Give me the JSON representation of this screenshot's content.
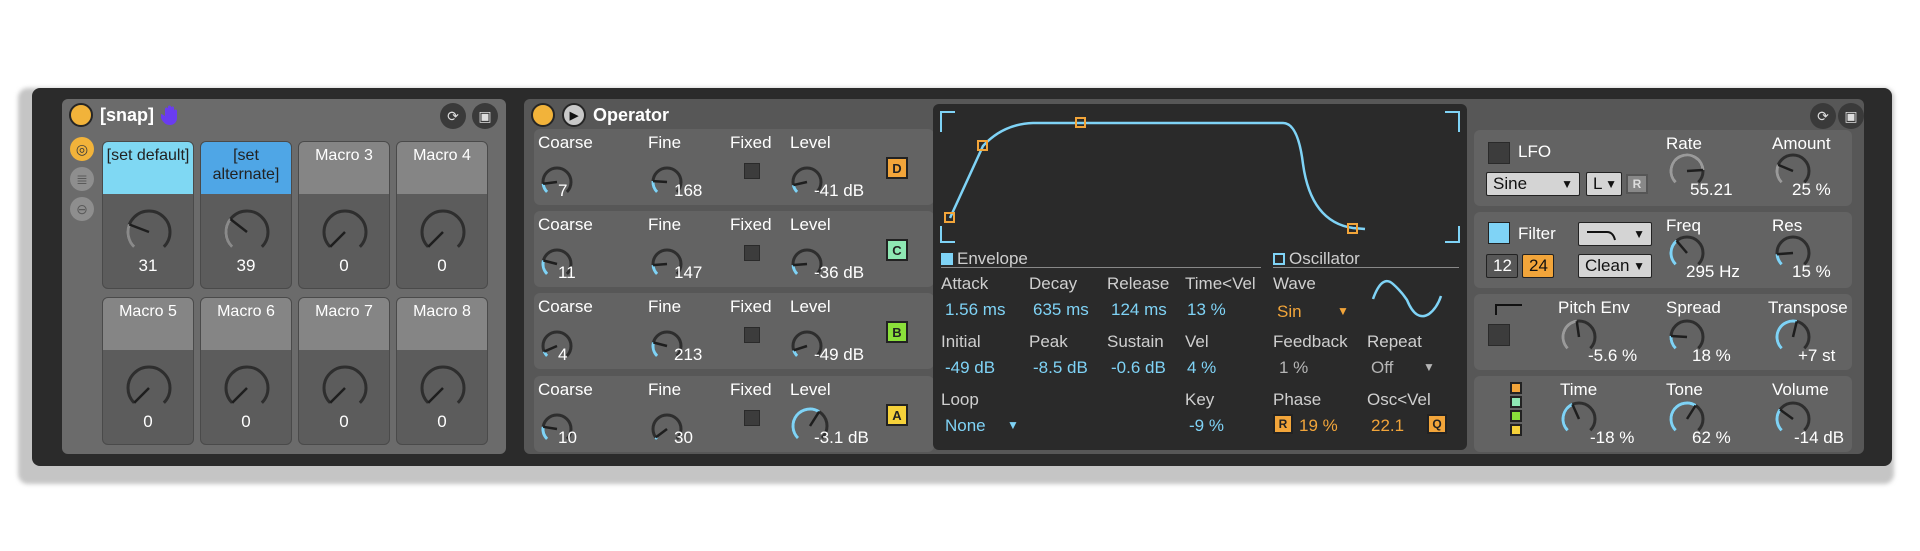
{
  "rack": {
    "title": "[snap]",
    "macros": [
      {
        "label": "[set default]",
        "value": "31",
        "fill": "#7fd8f3"
      },
      {
        "label": "[set alternate]",
        "value": "39",
        "fill": "#4fa6e6"
      },
      {
        "label": "Macro 3",
        "value": "0",
        "fill": "#858585"
      },
      {
        "label": "Macro 4",
        "value": "0",
        "fill": "#858585"
      },
      {
        "label": "Macro 5",
        "value": "0",
        "fill": "#858585"
      },
      {
        "label": "Macro 6",
        "value": "0",
        "fill": "#858585"
      },
      {
        "label": "Macro 7",
        "value": "0",
        "fill": "#858585"
      },
      {
        "label": "Macro 8",
        "value": "0",
        "fill": "#858585"
      }
    ]
  },
  "operator": {
    "title": "Operator",
    "oscillators": [
      {
        "coarse_label": "Coarse",
        "coarse": "7",
        "fine_label": "Fine",
        "fine": "168",
        "fixed_label": "Fixed",
        "level_label": "Level",
        "level": "-41 dB",
        "op": "D",
        "op_color": "#f2a53a"
      },
      {
        "coarse_label": "Coarse",
        "coarse": "11",
        "fine_label": "Fine",
        "fine": "147",
        "fixed_label": "Fixed",
        "level_label": "Level",
        "level": "-36 dB",
        "op": "C",
        "op_color": "#8fe8b4"
      },
      {
        "coarse_label": "Coarse",
        "coarse": "4",
        "fine_label": "Fine",
        "fine": "213",
        "fixed_label": "Fixed",
        "level_label": "Level",
        "level": "-49 dB",
        "op": "B",
        "op_color": "#8be03a"
      },
      {
        "coarse_label": "Coarse",
        "coarse": "10",
        "fine_label": "Fine",
        "fine": "30",
        "fixed_label": "Fixed",
        "level_label": "Level",
        "level": "-3.1 dB",
        "op": "A",
        "op_color": "#f6d23a"
      }
    ],
    "envelope": {
      "title": "Envelope",
      "attack_label": "Attack",
      "attack": "1.56 ms",
      "decay_label": "Decay",
      "decay": "635 ms",
      "release_label": "Release",
      "release": "124 ms",
      "timevel_label": "Time<Vel",
      "timevel": "13 %",
      "initial_label": "Initial",
      "initial": "-49 dB",
      "peak_label": "Peak",
      "peak": "-8.5 dB",
      "sustain_label": "Sustain",
      "sustain": "-0.6 dB",
      "vel_label": "Vel",
      "vel": "4 %",
      "loop_label": "Loop",
      "loop": "None",
      "key_label": "Key",
      "key": "-9 %"
    },
    "oscillator": {
      "title": "Oscillator",
      "wave_label": "Wave",
      "wave": "Sin",
      "feedback_label": "Feedback",
      "feedback": "1 %",
      "repeat_label": "Repeat",
      "repeat": "Off",
      "phase_label": "Phase",
      "phase_btn": "R",
      "phase": "19 %",
      "oscvel_label": "Osc<Vel",
      "oscvel": "22.1",
      "q_btn": "Q"
    },
    "lfo": {
      "title": "LFO",
      "wave": "Sine",
      "dest": "L",
      "r_btn": "R",
      "rate_label": "Rate",
      "rate": "55.21",
      "amount_label": "Amount",
      "amount": "25 %"
    },
    "filter": {
      "title": "Filter",
      "slope12": "12",
      "slope24": "24",
      "circuit": "Clean",
      "freq_label": "Freq",
      "freq": "295 Hz",
      "res_label": "Res",
      "res": "15 %"
    },
    "pitch": {
      "pitchenv_label": "Pitch Env",
      "pitchenv": "-5.6 %",
      "spread_label": "Spread",
      "spread": "18 %",
      "transpose_label": "Transpose",
      "transpose": "+7 st"
    },
    "global": {
      "time_label": "Time",
      "time": "-18 %",
      "tone_label": "Tone",
      "tone": "62 %",
      "volume_label": "Volume",
      "volume": "-14 dB"
    }
  }
}
